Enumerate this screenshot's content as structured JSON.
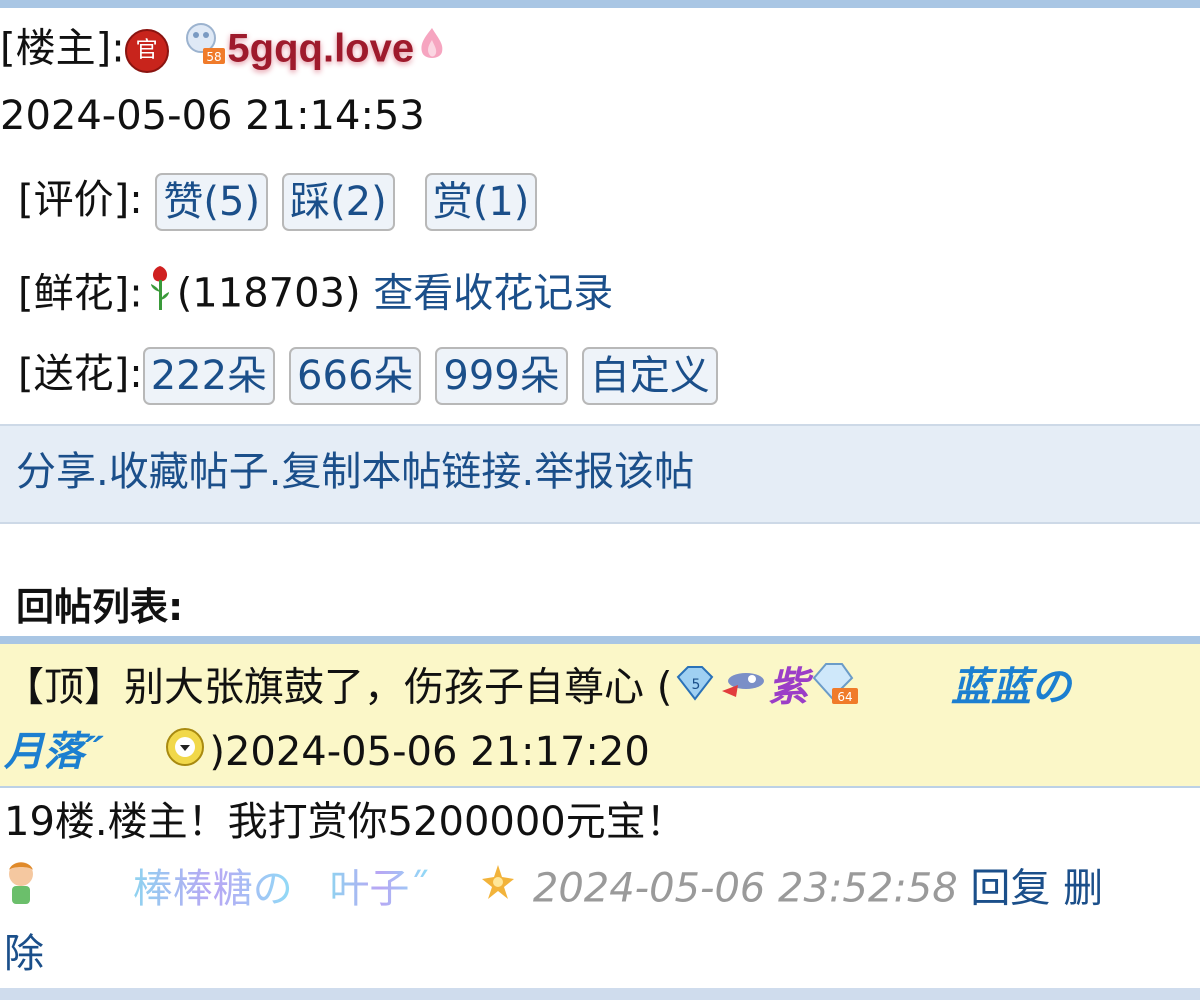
{
  "post": {
    "author_prefix": "[楼主]:",
    "official_badge": "官",
    "level_badge": "58",
    "author_name": "5gqq.love",
    "timestamp": "2024-05-06 21:14:53"
  },
  "rating": {
    "label": "[评价]:",
    "like": "赞(5)",
    "dislike": "踩(2)",
    "reward": "赏(1)"
  },
  "flowers": {
    "label": "[鲜花]:",
    "count": "(118703)",
    "view_link": "查看收花记录"
  },
  "send_flowers": {
    "label": "[送花]:",
    "options": [
      "222朵",
      "666朵",
      "999朵",
      "自定义"
    ]
  },
  "actions": {
    "share": "分享",
    "collect": "收藏帖子",
    "copy_link": "复制本帖链接",
    "report": "举报该帖",
    "sep": "."
  },
  "reply_list": {
    "title": "回帖列表:"
  },
  "top_reply": {
    "tag": "【顶】",
    "text": "别大张旗鼓了，伤孩子自尊心 (",
    "badge_level": "64",
    "badge_purple": "紫",
    "author_part1": "蓝蓝の",
    "author_part2": "月落˝",
    "closing": ")",
    "timestamp": "2024-05-06 21:17:20"
  },
  "reply": {
    "content": "19楼.楼主！我打赏你5200000元宝！",
    "author_a": "棒棒糖の",
    "author_b": "叶子˝",
    "timestamp": "2024-05-06 23:52:58",
    "reply_link": "回复",
    "delete_link_1": "删",
    "delete_link_2": "除"
  },
  "colors": {
    "link": "#1b4f8a",
    "top_reply_bg": "#fbf7c8",
    "divider": "#a9c6e4"
  }
}
